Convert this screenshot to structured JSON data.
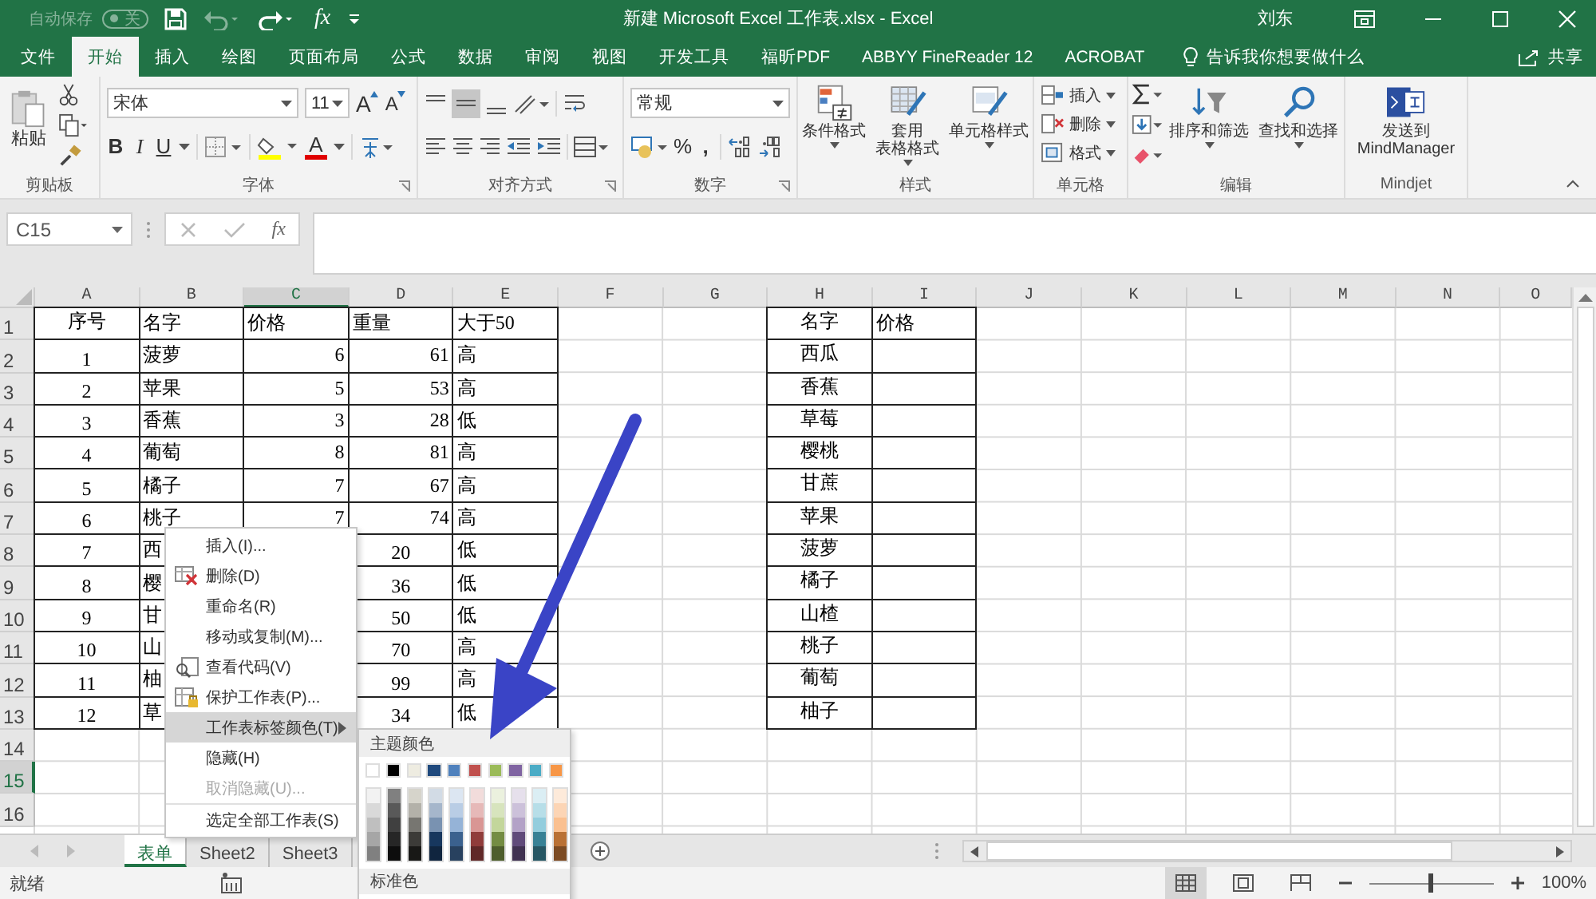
{
  "title_bar": {
    "autosave_label": "自动保存",
    "autosave_on": false,
    "autosave_state": "关",
    "fx": "fx",
    "title": "新建 Microsoft Excel 工作表.xlsx  -  Excel",
    "user": "刘东"
  },
  "tabs": [
    {
      "label": "文件",
      "selected": false
    },
    {
      "label": "开始",
      "selected": true
    },
    {
      "label": "插入",
      "selected": false
    },
    {
      "label": "绘图",
      "selected": false
    },
    {
      "label": "页面布局",
      "selected": false
    },
    {
      "label": "公式",
      "selected": false
    },
    {
      "label": "数据",
      "selected": false
    },
    {
      "label": "审阅",
      "selected": false
    },
    {
      "label": "视图",
      "selected": false
    },
    {
      "label": "开发工具",
      "selected": false
    },
    {
      "label": "福昕PDF",
      "selected": false
    },
    {
      "label": "ABBYY FineReader 12",
      "selected": false
    },
    {
      "label": "ACROBAT",
      "selected": false
    }
  ],
  "tell_me": "告诉我你想要做什么",
  "share": "共享",
  "clipboard": {
    "paste": "粘贴",
    "label": "剪贴板"
  },
  "font": {
    "name": "宋体",
    "size": "11",
    "grow": "A",
    "shrink": "A",
    "bold": "B",
    "italic": "I",
    "underline": "U",
    "color_letter": "A",
    "label": "字体"
  },
  "alignment": {
    "label": "对齐方式"
  },
  "number": {
    "format": "常规",
    "percent": "%",
    "comma": ",",
    "label": "数字"
  },
  "styles": {
    "buttons": [
      {
        "lines": [
          "条件格式"
        ],
        "kind": "conditional"
      },
      {
        "lines": [
          "套用",
          "表格格式"
        ],
        "kind": "table"
      },
      {
        "lines": [
          "单元格样式"
        ],
        "kind": "cellstyle"
      }
    ],
    "label": "样式"
  },
  "cells": {
    "buttons": [
      {
        "label": "插入",
        "kind": "insert"
      },
      {
        "label": "删除",
        "kind": "delete"
      },
      {
        "label": "格式",
        "kind": "format"
      }
    ],
    "label": "单元格"
  },
  "editing": {
    "buttons": [
      {
        "label": "排序和筛选",
        "kind": "sort"
      },
      {
        "label": "查找和选择",
        "kind": "find"
      }
    ],
    "label": "编辑"
  },
  "mindjet": {
    "lines": [
      "发送到",
      "MindManager"
    ],
    "label": "Mindjet"
  },
  "formula_bar": {
    "name_box": "C15",
    "fx": "fx"
  },
  "sheet": {
    "columns": [
      {
        "label": "A",
        "selected": false
      },
      {
        "label": "B",
        "selected": false
      },
      {
        "label": "C",
        "selected": true
      },
      {
        "label": "D",
        "selected": false
      },
      {
        "label": "E",
        "selected": false
      },
      {
        "label": "F",
        "selected": false
      },
      {
        "label": "G",
        "selected": false
      },
      {
        "label": "H",
        "selected": false
      },
      {
        "label": "I",
        "selected": false
      },
      {
        "label": "J",
        "selected": false
      },
      {
        "label": "K",
        "selected": false
      },
      {
        "label": "L",
        "selected": false
      },
      {
        "label": "M",
        "selected": false
      },
      {
        "label": "N",
        "selected": false
      },
      {
        "label": "O",
        "selected": false
      }
    ],
    "rows": [
      {
        "label": "1",
        "selected": false,
        "cells": {
          "A": {
            "text": "序号",
            "bordered": true
          },
          "B": {
            "text": "名字",
            "bordered": true
          },
          "C": {
            "text": "价格",
            "bordered": true
          },
          "D": {
            "text": "重量",
            "bordered": true
          },
          "E": {
            "text": "大于50",
            "bordered": true
          },
          "H": {
            "text": "名字",
            "bordered": true
          },
          "I": {
            "text": "价格",
            "bordered": true
          }
        }
      },
      {
        "label": "2",
        "selected": false,
        "cells": {
          "A": {
            "text": "1",
            "bordered": true
          },
          "B": {
            "text": "菠萝",
            "bordered": true
          },
          "C": {
            "text": "6",
            "bordered": true
          },
          "D": {
            "text": "61",
            "bordered": true
          },
          "E": {
            "text": "高",
            "bordered": true
          },
          "H": {
            "text": "西瓜",
            "bordered": true
          },
          "I": {
            "bordered": true
          }
        }
      },
      {
        "label": "3",
        "selected": false,
        "cells": {
          "A": {
            "text": "2",
            "bordered": true
          },
          "B": {
            "text": "苹果",
            "bordered": true
          },
          "C": {
            "text": "5",
            "bordered": true
          },
          "D": {
            "text": "53",
            "bordered": true
          },
          "E": {
            "text": "高",
            "bordered": true
          },
          "H": {
            "text": "香蕉",
            "bordered": true
          },
          "I": {
            "bordered": true
          }
        }
      },
      {
        "label": "4",
        "selected": false,
        "cells": {
          "A": {
            "text": "3",
            "bordered": true
          },
          "B": {
            "text": "香蕉",
            "bordered": true
          },
          "C": {
            "text": "3",
            "bordered": true
          },
          "D": {
            "text": "28",
            "bordered": true
          },
          "E": {
            "text": "低",
            "bordered": true
          },
          "H": {
            "text": "草莓",
            "bordered": true
          },
          "I": {
            "bordered": true
          }
        }
      },
      {
        "label": "5",
        "selected": false,
        "cells": {
          "A": {
            "text": "4",
            "bordered": true
          },
          "B": {
            "text": "葡萄",
            "bordered": true
          },
          "C": {
            "text": "8",
            "bordered": true
          },
          "D": {
            "text": "81",
            "bordered": true
          },
          "E": {
            "text": "高",
            "bordered": true
          },
          "H": {
            "text": "樱桃",
            "bordered": true
          },
          "I": {
            "bordered": true
          }
        }
      },
      {
        "label": "6",
        "selected": false,
        "cells": {
          "A": {
            "text": "5",
            "bordered": true
          },
          "B": {
            "text": "橘子",
            "bordered": true
          },
          "C": {
            "text": "7",
            "bordered": true
          },
          "D": {
            "text": "67",
            "bordered": true
          },
          "E": {
            "text": "高",
            "bordered": true
          },
          "H": {
            "text": "甘蔗",
            "bordered": true
          },
          "I": {
            "bordered": true
          }
        }
      },
      {
        "label": "7",
        "selected": false,
        "cells": {
          "A": {
            "text": "6",
            "bordered": true
          },
          "B": {
            "text": "桃子",
            "bordered": true
          },
          "C": {
            "text": "7",
            "bordered": true
          },
          "D": {
            "text": "74",
            "bordered": true
          },
          "E": {
            "text": "高",
            "bordered": true
          },
          "H": {
            "text": "苹果",
            "bordered": true
          },
          "I": {
            "bordered": true
          }
        }
      },
      {
        "label": "8",
        "selected": false,
        "cells": {
          "A": {
            "text": "7",
            "bordered": true
          },
          "B": {
            "text": "西",
            "bordered": true
          },
          "D": {
            "text": "20",
            "bordered": true
          },
          "E": {
            "text": "低",
            "bordered": true
          },
          "H": {
            "text": "菠萝",
            "bordered": true
          },
          "I": {
            "bordered": true
          }
        }
      },
      {
        "label": "9",
        "selected": false,
        "cells": {
          "A": {
            "text": "8",
            "bordered": true
          },
          "B": {
            "text": "樱",
            "bordered": true
          },
          "D": {
            "text": "36",
            "bordered": true
          },
          "E": {
            "text": "低",
            "bordered": true
          },
          "H": {
            "text": "橘子",
            "bordered": true
          },
          "I": {
            "bordered": true
          }
        }
      },
      {
        "label": "10",
        "selected": false,
        "cells": {
          "A": {
            "text": "9",
            "bordered": true
          },
          "B": {
            "text": "甘",
            "bordered": true
          },
          "D": {
            "text": "50",
            "bordered": true
          },
          "E": {
            "text": "低",
            "bordered": true
          },
          "H": {
            "text": "山楂",
            "bordered": true
          },
          "I": {
            "bordered": true
          }
        }
      },
      {
        "label": "11",
        "selected": false,
        "cells": {
          "A": {
            "text": "10",
            "bordered": true
          },
          "B": {
            "text": "山",
            "bordered": true
          },
          "D": {
            "text": "70",
            "bordered": true
          },
          "E": {
            "text": "高",
            "bordered": true
          },
          "H": {
            "text": "桃子",
            "bordered": true
          },
          "I": {
            "bordered": true
          }
        }
      },
      {
        "label": "12",
        "selected": false,
        "cells": {
          "A": {
            "text": "11",
            "bordered": true
          },
          "B": {
            "text": "柚",
            "bordered": true
          },
          "D": {
            "text": "99",
            "bordered": true
          },
          "E": {
            "text": "高",
            "bordered": true
          },
          "H": {
            "text": "葡萄",
            "bordered": true
          },
          "I": {
            "bordered": true
          }
        }
      },
      {
        "label": "13",
        "selected": false,
        "cells": {
          "A": {
            "text": "12",
            "bordered": true
          },
          "B": {
            "text": "草",
            "bordered": true
          },
          "D": {
            "text": "34",
            "bordered": true
          },
          "E": {
            "text": "低",
            "bordered": true
          },
          "H": {
            "text": "柚子",
            "bordered": true
          },
          "I": {
            "bordered": true
          }
        }
      },
      {
        "label": "14",
        "selected": false
      },
      {
        "label": "15",
        "selected": true
      },
      {
        "label": "16",
        "selected": false
      }
    ]
  },
  "context_menu": {
    "items": [
      {
        "label": "插入(I)...",
        "kind": "plain",
        "selected": false,
        "disabled": false,
        "submenu": false,
        "separator_before": false
      },
      {
        "label": "删除(D)",
        "kind": "delete",
        "selected": false,
        "disabled": false,
        "submenu": false,
        "separator_before": false
      },
      {
        "label": "重命名(R)",
        "kind": "plain",
        "selected": false,
        "disabled": false,
        "submenu": false,
        "separator_before": false
      },
      {
        "label": "移动或复制(M)...",
        "kind": "plain",
        "selected": false,
        "disabled": false,
        "submenu": false,
        "separator_before": false
      },
      {
        "label": "查看代码(V)",
        "kind": "code",
        "selected": false,
        "disabled": false,
        "submenu": false,
        "separator_before": false
      },
      {
        "label": "保护工作表(P)...",
        "kind": "protect",
        "selected": false,
        "disabled": false,
        "submenu": false,
        "separator_before": false
      },
      {
        "label": "工作表标签颜色(T)",
        "kind": "plain",
        "selected": true,
        "disabled": false,
        "submenu": true,
        "separator_before": false
      },
      {
        "label": "隐藏(H)",
        "kind": "plain",
        "selected": false,
        "disabled": false,
        "submenu": false,
        "separator_before": false
      },
      {
        "label": "取消隐藏(U)...",
        "kind": "plain",
        "selected": false,
        "disabled": true,
        "submenu": false,
        "separator_before": false
      },
      {
        "label": "选定全部工作表(S)",
        "kind": "plain",
        "selected": false,
        "disabled": false,
        "submenu": false,
        "separator_before": true
      }
    ]
  },
  "color_submenu": {
    "theme_title": "主题颜色",
    "theme_colors": [
      {
        "color": "#ffffff"
      },
      {
        "color": "#000000"
      },
      {
        "color": "#eeece1"
      },
      {
        "color": "#1f497d"
      },
      {
        "color": "#4f81bd"
      },
      {
        "color": "#c0504d"
      },
      {
        "color": "#9bbb59"
      },
      {
        "color": "#8064a2"
      },
      {
        "color": "#4bacc6"
      },
      {
        "color": "#f79646"
      }
    ],
    "standard_title": "标准色"
  },
  "sheet_tabs": [
    {
      "label": "表单",
      "selected": true
    },
    {
      "label": "Sheet2",
      "selected": false
    },
    {
      "label": "Sheet3",
      "selected": false
    }
  ],
  "status_bar": {
    "status": "就绪",
    "zoom": "100%",
    "level": 0.5
  }
}
